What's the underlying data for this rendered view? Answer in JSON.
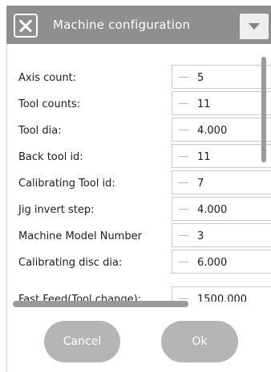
{
  "dialog": {
    "title": "Machine configuration",
    "close_icon": "close-icon",
    "dropdown_icon": "chevron-down-icon"
  },
  "rows": [
    {
      "label": "Axis count:",
      "value": "5"
    },
    {
      "label": "Tool counts:",
      "value": "11"
    },
    {
      "label": "Tool dia:",
      "value": "4.000"
    },
    {
      "label": "Back tool id:",
      "value": "11"
    },
    {
      "label": "Calibrating Tool id:",
      "value": "7"
    },
    {
      "label": "Jig invert step:",
      "value": "4.000"
    },
    {
      "label": "Machine Model Number",
      "value": "3"
    },
    {
      "label": "Calibrating disc dia:",
      "value": "6.000"
    },
    {
      "label": "Fast Feed(Tool change):",
      "value": "1500.000"
    }
  ],
  "buttons": {
    "cancel": "Cancel",
    "ok": "Ok"
  },
  "colors": {
    "titlebar": "#8f8f8f",
    "button": "#b5b5b5",
    "scrollbar": "#9a9a9a"
  }
}
